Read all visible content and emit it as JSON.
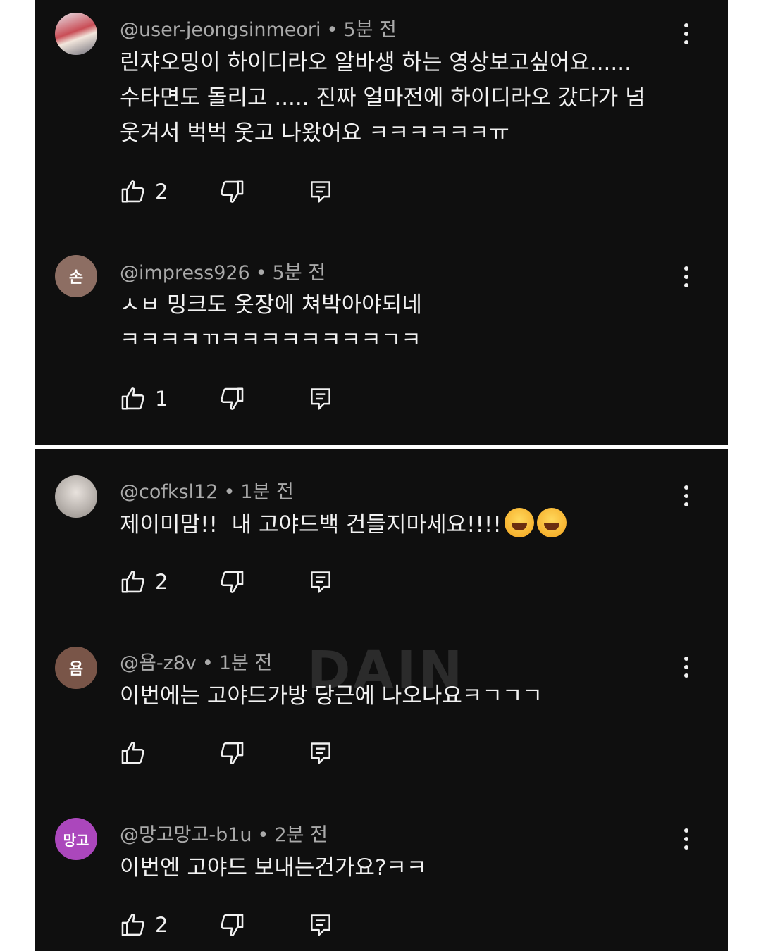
{
  "comments_top": [
    {
      "author": "@user-jeongsinmeori",
      "time": "5분 전",
      "text": "린쟈오밍이 하이디라오 알바생 하는 영상보고싶어요......\n수타면도 돌리고 ..... 진짜 얼마전에 하이디라오 갔다가 넘\n웃겨서 벅벅 웃고 나왔어요 ㅋㅋㅋㅋㅋㅋㅠ",
      "likes": "2",
      "avatar_letter": ""
    },
    {
      "author": "@impress926",
      "time": "5분 전",
      "text": "ㅅㅂ 밍크도 옷장에 쳐박아야되네\nㅋㅋㅋㅋㄲㅋㅋㅋㅋㅋㅋㅋㅋㄱㅋ",
      "likes": "1",
      "avatar_letter": "손"
    }
  ],
  "comments_bottom": [
    {
      "author": "@cofksl12",
      "time": "1분 전",
      "text": "제이미맘!!  내 고야드백 건들지마세요!!!!",
      "likes": "2",
      "avatar_letter": ""
    },
    {
      "author": "@욤-z8v",
      "time": "1분 전",
      "text": "이번에는 고야드가방 당근에 나오나요ㅋㄱㄱㄱ",
      "likes": "",
      "avatar_letter": "욤"
    },
    {
      "author": "@망고망고-b1u",
      "time": "2분 전",
      "text": "이번엔 고야드 보내는건가요?ㅋㅋ",
      "likes": "2",
      "avatar_letter": "망고"
    }
  ],
  "watermark": "DAIN",
  "colors": {
    "background": "#0f0f0f",
    "text": "#f1f1f1",
    "meta": "#aaaaaa",
    "avatar_son": "#8d6e63",
    "avatar_yom": "#795548",
    "avatar_mango": "#ab47bc"
  },
  "icons": [
    "like-icon",
    "dislike-icon",
    "reply-icon",
    "more-vert-icon"
  ]
}
